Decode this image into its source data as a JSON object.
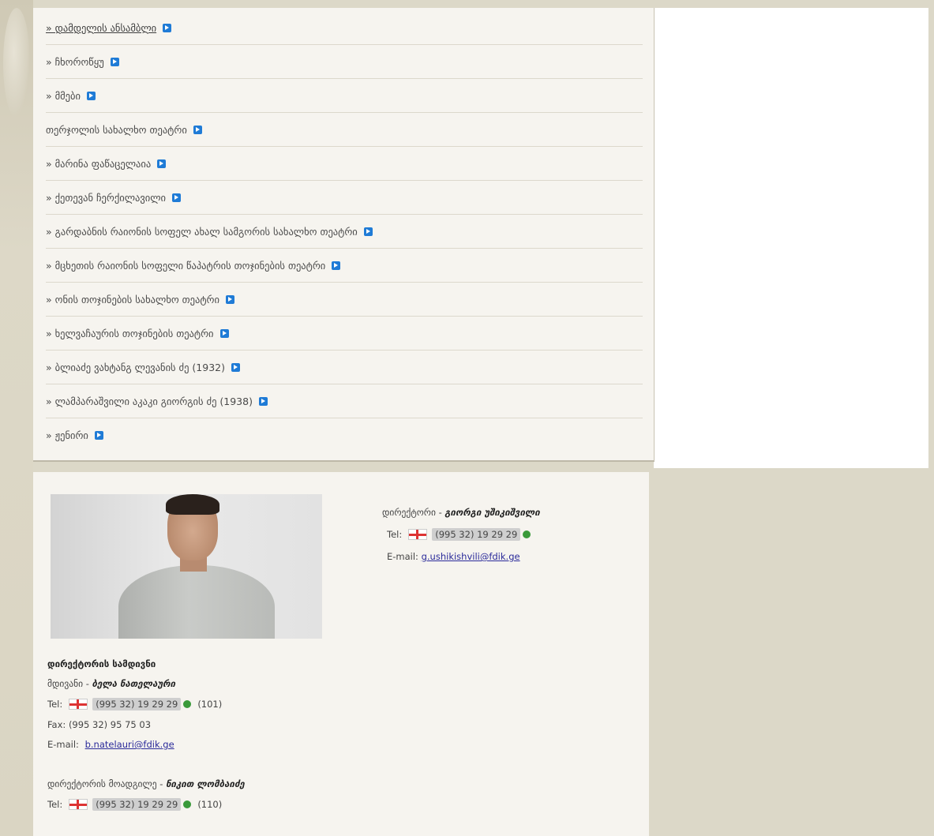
{
  "menu": {
    "items": [
      {
        "label": "» დამდელის ანსამბლი",
        "active": true
      },
      {
        "label": "» ჩხოროწყუ"
      },
      {
        "label": "» მმები"
      },
      {
        "label": "თერჯოლის სახალხო თეატრი"
      },
      {
        "label": "» მარინა ფაწაცელაია"
      },
      {
        "label": "» ქეთევან ჩერქილავილი"
      },
      {
        "label": "» გარდაბნის რაიონის სოფელ ახალ სამგორის სახალხო თეატრი"
      },
      {
        "label": "» მცხეთის რაიონის სოფელი წაპატრის თოჯინების თეატრი"
      },
      {
        "label": "» ონის თოჯინების სახალხო თეატრი"
      },
      {
        "label": "» ხელვაჩაურის თოჯინების თეატრი"
      },
      {
        "label": "» ბლიაძე ვახტანგ ლევანის ძე (1932)"
      },
      {
        "label": "» ლამპარაშვილი აკაკი გიორგის ძე (1938)"
      },
      {
        "label": "» ჟენირი"
      }
    ]
  },
  "director": {
    "role": "დირექტორი -",
    "name": "გიორგი უშიკიშვილი",
    "tel_label": "Tel:",
    "phone": "(995 32) 19 29 29",
    "email_label": "E-mail:",
    "email": "g.ushikishvili@fdik.ge"
  },
  "office": {
    "title": "დირექტორის სამდივნი",
    "secretary_role": "მდივანი -",
    "secretary_name": "ბელა ნათელაური",
    "tel_label": "Tel:",
    "phone": "(995 32) 19 29 29",
    "phone_ext": "(101)",
    "fax": "Fax: (995 32) 95 75 03",
    "email_label": "E-mail:",
    "email": "b.natelauri@fdik.ge",
    "deputy_role": "დირექტორის მოადგილე -",
    "deputy_name": "ნიკით ლომბაიძე",
    "deputy_tel_label": "Tel:",
    "deputy_phone": "(995 32) 19 29 29",
    "deputy_ext": "(110)"
  },
  "icons": {
    "external": "external-link-icon",
    "flag": "georgia-flag-icon",
    "phone": "phone-icon"
  },
  "colors": {
    "link_icon": "#1f7bd6",
    "phone_icon": "#3a9a3a",
    "page_bg": "#dcd8c8",
    "panel_bg": "#f6f4ef"
  }
}
